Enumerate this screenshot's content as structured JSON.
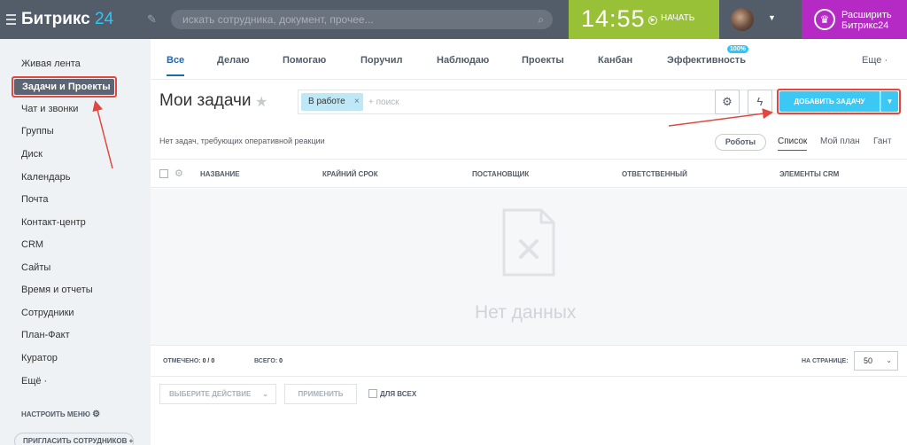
{
  "header": {
    "logo_text": "Битрикс",
    "logo_number": "24",
    "search_placeholder": "искать сотрудника, документ, прочее...",
    "time": "14:55",
    "start_label": "НАЧАТЬ",
    "upgrade_line1": "Расширить",
    "upgrade_line2": "Битрикс24"
  },
  "sidebar": {
    "items": [
      {
        "label": "Живая лента"
      },
      {
        "label": "Задачи и Проекты"
      },
      {
        "label": "Чат и звонки"
      },
      {
        "label": "Группы"
      },
      {
        "label": "Диск"
      },
      {
        "label": "Календарь"
      },
      {
        "label": "Почта"
      },
      {
        "label": "Контакт-центр"
      },
      {
        "label": "CRM"
      },
      {
        "label": "Сайты"
      },
      {
        "label": "Время и отчеты"
      },
      {
        "label": "Сотрудники"
      },
      {
        "label": "План-Факт"
      },
      {
        "label": "Куратор"
      },
      {
        "label": "Ещё ·"
      }
    ],
    "configure_label": "НАСТРОИТЬ МЕНЮ",
    "invite_label": "ПРИГЛАСИТЬ СОТРУДНИКОВ"
  },
  "tabs": {
    "items": [
      {
        "label": "Все"
      },
      {
        "label": "Делаю"
      },
      {
        "label": "Помогаю"
      },
      {
        "label": "Поручил"
      },
      {
        "label": "Наблюдаю"
      },
      {
        "label": "Проекты"
      },
      {
        "label": "Канбан"
      },
      {
        "label": "Эффективность"
      },
      {
        "label": "Еще ·"
      }
    ],
    "efficiency_badge": "100%"
  },
  "page": {
    "title": "Мои задачи",
    "filter_chip": "В работе",
    "filter_placeholder": "+ поиск",
    "add_task_label": "ДОБАВИТЬ ЗАДАЧУ",
    "no_tasks_text": "Нет задач, требующих оперативной реакции",
    "robots_label": "Роботы",
    "views": [
      "Список",
      "Мой план",
      "Гант"
    ]
  },
  "grid": {
    "columns": [
      "НАЗВАНИЕ",
      "КРАЙНИЙ СРОК",
      "ПОСТАНОВЩИК",
      "ОТВЕТСТВЕННЫЙ",
      "ЭЛЕМЕНТЫ CRM"
    ],
    "empty_text": "Нет данных"
  },
  "footer": {
    "marked_label": "ОТМЕЧЕНО:",
    "marked_value": "0 / 0",
    "total_label": "ВСЕГО:",
    "total_value": "0",
    "per_page_label": "НА СТРАНИЦЕ:",
    "per_page_value": "50"
  },
  "actions": {
    "select_action": "ВЫБЕРИТЕ ДЕЙСТВИЕ",
    "apply_label": "ПРИМЕНИТЬ",
    "for_all_label": "ДЛЯ ВСЕХ"
  },
  "colors": {
    "header_bg": "#535c69",
    "clock_bg": "#98c138",
    "upgrade_bg": "#b52ac5",
    "accent_blue": "#3bc8f5",
    "annotation_red": "#e0473f"
  }
}
